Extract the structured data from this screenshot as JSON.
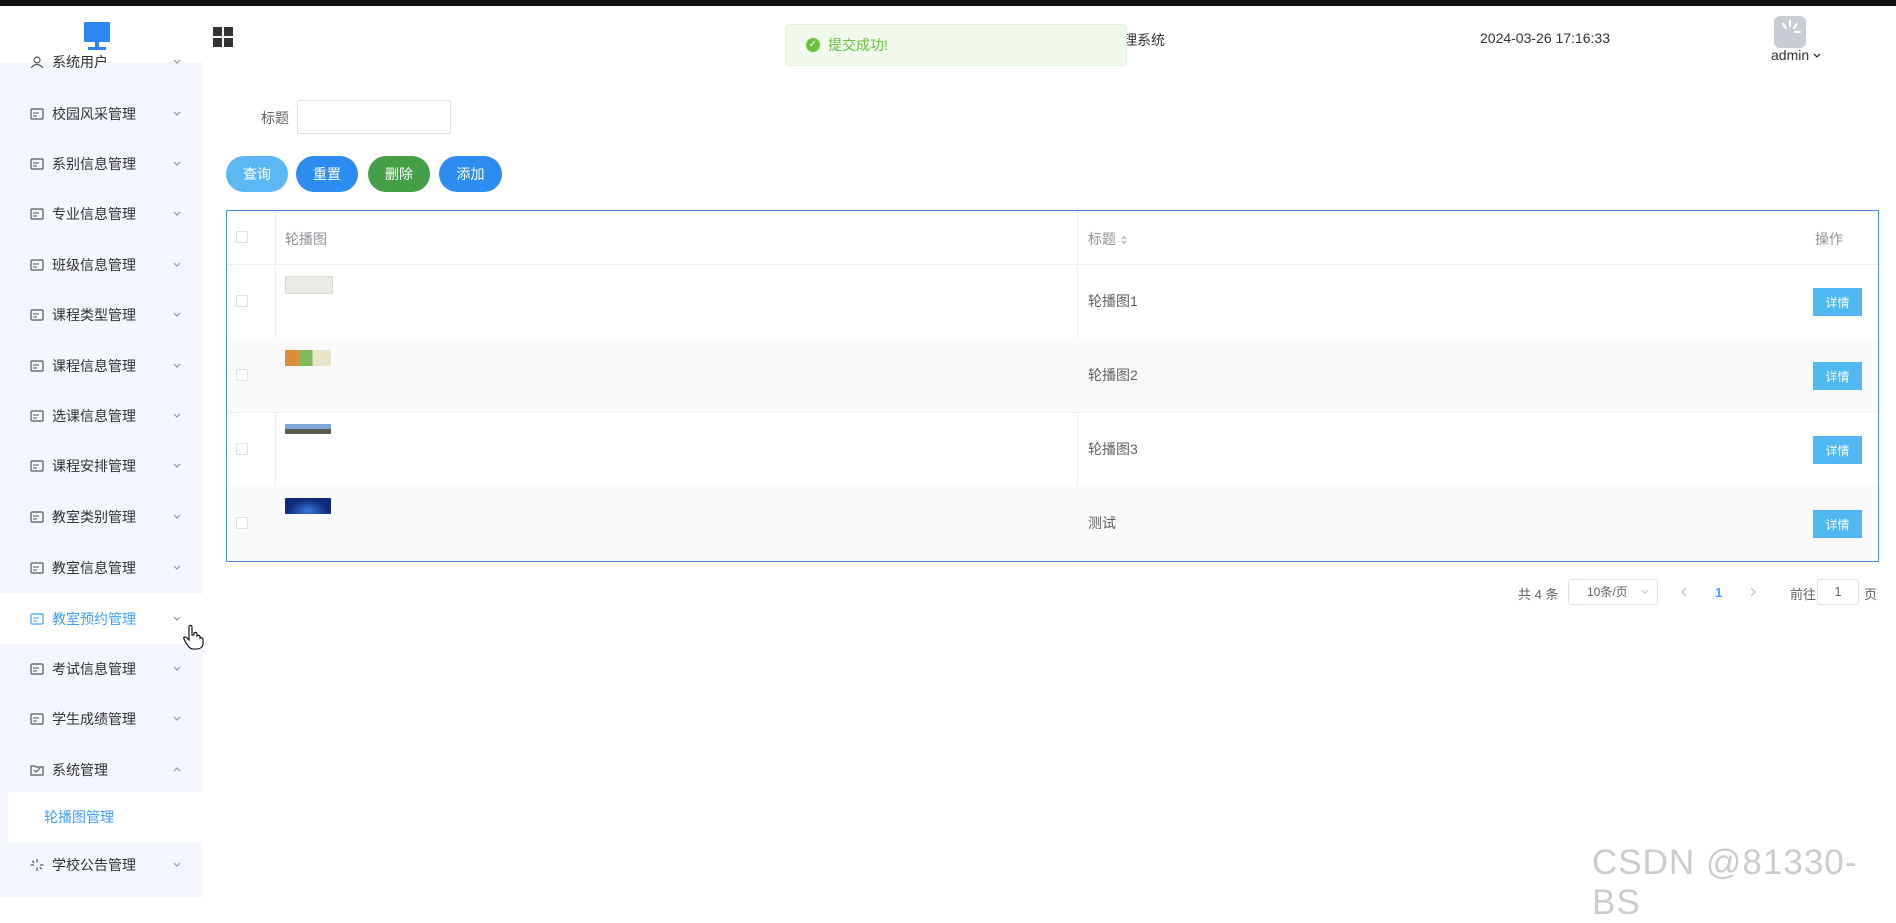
{
  "header": {
    "system_title_fragment": "理系统",
    "datetime": "2024-03-26 17:16:33",
    "user": "admin",
    "logo_icon": "monitor-icon",
    "apps_icon": "grid-icon"
  },
  "toast": {
    "message": "提交成功!",
    "type": "success"
  },
  "sidebar": {
    "items": [
      {
        "label": "系统用户",
        "icon": "user-icon"
      },
      {
        "label": "校园风采管理",
        "icon": "card-icon"
      },
      {
        "label": "系别信息管理",
        "icon": "card-icon"
      },
      {
        "label": "专业信息管理",
        "icon": "card-icon"
      },
      {
        "label": "班级信息管理",
        "icon": "card-icon"
      },
      {
        "label": "课程类型管理",
        "icon": "card-icon"
      },
      {
        "label": "课程信息管理",
        "icon": "card-icon"
      },
      {
        "label": "选课信息管理",
        "icon": "card-icon"
      },
      {
        "label": "课程安排管理",
        "icon": "card-icon"
      },
      {
        "label": "教室类别管理",
        "icon": "card-icon"
      },
      {
        "label": "教室信息管理",
        "icon": "card-icon"
      },
      {
        "label": "教室预约管理",
        "icon": "card-icon",
        "hovered": true
      },
      {
        "label": "考试信息管理",
        "icon": "card-icon"
      },
      {
        "label": "学生成绩管理",
        "icon": "card-icon"
      },
      {
        "label": "系统管理",
        "icon": "folder-icon",
        "expanded": true
      },
      {
        "label": "学校公告管理",
        "icon": "loading-icon"
      }
    ],
    "submenu_active": "轮播图管理"
  },
  "filter": {
    "label": "标题",
    "value": ""
  },
  "buttons": {
    "query": "查询",
    "reset": "重置",
    "delete": "删除",
    "add": "添加"
  },
  "table": {
    "columns": {
      "image": "轮播图",
      "title": "标题",
      "action": "操作"
    },
    "rows": [
      {
        "title": "轮播图1",
        "thumb_color": "#e9ece4",
        "action": "详情"
      },
      {
        "title": "轮播图2",
        "thumb_color": "#d98e3a",
        "action": "详情"
      },
      {
        "title": "轮播图3",
        "thumb_color": "#5b7aa8",
        "action": "详情"
      },
      {
        "title": "测试",
        "thumb_color": "#0d2b78",
        "action": "详情"
      }
    ]
  },
  "pagination": {
    "total": "共 4 条",
    "page_size": "10条/页",
    "current": "1",
    "goto_label": "前往",
    "goto_value": "1",
    "unit": "页"
  },
  "colors": {
    "primary": "#409eff",
    "success": "#67c23a",
    "sidebar_bg": "#f3f6fd",
    "detail_btn": "#4fb8f0"
  },
  "watermark": "CSDN @81330-BS"
}
